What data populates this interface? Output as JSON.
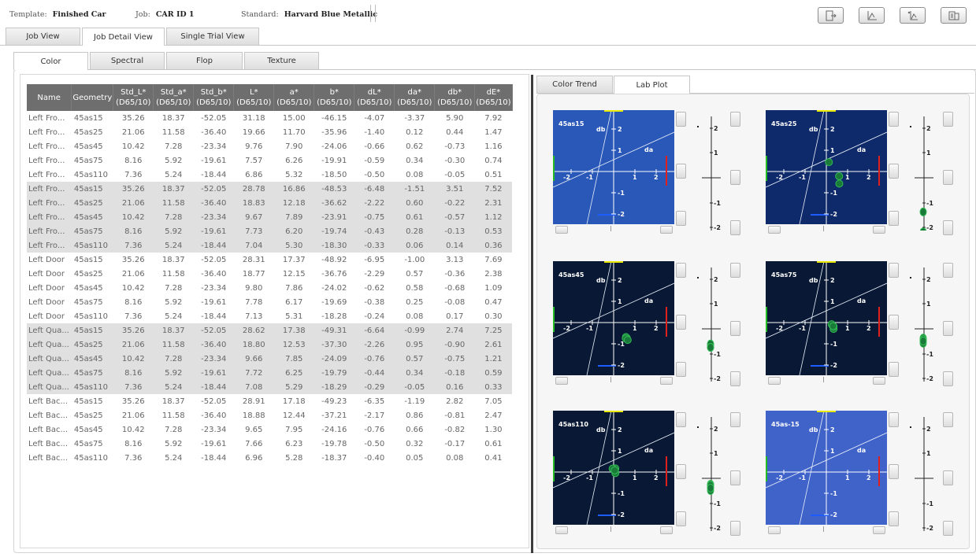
{
  "header": {
    "template_label": "Template:",
    "template_value": "Finished Car",
    "job_label": "Job:",
    "job_value": "CAR ID 1",
    "standard_label": "Standard:",
    "standard_value": "Harvard Blue Metallic"
  },
  "toolbar": {
    "buttons": [
      {
        "name": "export-icon"
      },
      {
        "name": "chart-icon"
      },
      {
        "name": "chart-star-icon"
      },
      {
        "name": "report-icon"
      }
    ]
  },
  "main_tabs": [
    "Job View",
    "Job Detail View",
    "Single Trial View"
  ],
  "main_active": 1,
  "sub_tabs": [
    "Color",
    "Spectral",
    "Flop",
    "Texture"
  ],
  "sub_active": 0,
  "right_tabs": [
    "Color Trend",
    "Lab Plot"
  ],
  "right_active": 1,
  "table": {
    "columns": [
      {
        "l1": "Name",
        "l2": ""
      },
      {
        "l1": "Geometry",
        "l2": ""
      },
      {
        "l1": "Std_L*",
        "l2": "(D65/10)"
      },
      {
        "l1": "Std_a*",
        "l2": "(D65/10)"
      },
      {
        "l1": "Std_b*",
        "l2": "(D65/10)"
      },
      {
        "l1": "L*",
        "l2": "(D65/10)"
      },
      {
        "l1": "a*",
        "l2": "(D65/10)"
      },
      {
        "l1": "b*",
        "l2": "(D65/10)"
      },
      {
        "l1": "dL*",
        "l2": "(D65/10)"
      },
      {
        "l1": "da*",
        "l2": "(D65/10)"
      },
      {
        "l1": "db*",
        "l2": "(D65/10)"
      },
      {
        "l1": "dE*",
        "l2": "(D65/10)"
      }
    ],
    "rows": [
      [
        "Left Fro...",
        "45as15",
        "35.26",
        "18.37",
        "-52.05",
        "31.18",
        "15.00",
        "-46.15",
        "-4.07",
        "-3.37",
        "5.90",
        "7.92"
      ],
      [
        "Left Fro...",
        "45as25",
        "21.06",
        "11.58",
        "-36.40",
        "19.66",
        "11.70",
        "-35.96",
        "-1.40",
        "0.12",
        "0.44",
        "1.47"
      ],
      [
        "Left Fro...",
        "45as45",
        "10.42",
        "7.28",
        "-23.34",
        "9.76",
        "7.90",
        "-24.06",
        "-0.66",
        "0.62",
        "-0.73",
        "1.16"
      ],
      [
        "Left Fro...",
        "45as75",
        "8.16",
        "5.92",
        "-19.61",
        "7.57",
        "6.26",
        "-19.91",
        "-0.59",
        "0.34",
        "-0.30",
        "0.74"
      ],
      [
        "Left Fro...",
        "45as110",
        "7.36",
        "5.24",
        "-18.44",
        "6.86",
        "5.32",
        "-18.50",
        "-0.50",
        "0.08",
        "-0.05",
        "0.51"
      ],
      [
        "Left Fro...",
        "45as15",
        "35.26",
        "18.37",
        "-52.05",
        "28.78",
        "16.86",
        "-48.53",
        "-6.48",
        "-1.51",
        "3.51",
        "7.52"
      ],
      [
        "Left Fro...",
        "45as25",
        "21.06",
        "11.58",
        "-36.40",
        "18.83",
        "12.18",
        "-36.62",
        "-2.22",
        "0.60",
        "-0.22",
        "2.31"
      ],
      [
        "Left Fro...",
        "45as45",
        "10.42",
        "7.28",
        "-23.34",
        "9.67",
        "7.89",
        "-23.91",
        "-0.75",
        "0.61",
        "-0.57",
        "1.12"
      ],
      [
        "Left Fro...",
        "45as75",
        "8.16",
        "5.92",
        "-19.61",
        "7.73",
        "6.20",
        "-19.74",
        "-0.43",
        "0.28",
        "-0.13",
        "0.53"
      ],
      [
        "Left Fro...",
        "45as110",
        "7.36",
        "5.24",
        "-18.44",
        "7.04",
        "5.30",
        "-18.30",
        "-0.33",
        "0.06",
        "0.14",
        "0.36"
      ],
      [
        "Left Door",
        "45as15",
        "35.26",
        "18.37",
        "-52.05",
        "28.31",
        "17.37",
        "-48.92",
        "-6.95",
        "-1.00",
        "3.13",
        "7.69"
      ],
      [
        "Left Door",
        "45as25",
        "21.06",
        "11.58",
        "-36.40",
        "18.77",
        "12.15",
        "-36.76",
        "-2.29",
        "0.57",
        "-0.36",
        "2.38"
      ],
      [
        "Left Door",
        "45as45",
        "10.42",
        "7.28",
        "-23.34",
        "9.80",
        "7.86",
        "-24.02",
        "-0.62",
        "0.58",
        "-0.68",
        "1.09"
      ],
      [
        "Left Door",
        "45as75",
        "8.16",
        "5.92",
        "-19.61",
        "7.78",
        "6.17",
        "-19.69",
        "-0.38",
        "0.25",
        "-0.08",
        "0.47"
      ],
      [
        "Left Door",
        "45as110",
        "7.36",
        "5.24",
        "-18.44",
        "7.13",
        "5.31",
        "-18.28",
        "-0.24",
        "0.08",
        "0.17",
        "0.30"
      ],
      [
        "Left Qua...",
        "45as15",
        "35.26",
        "18.37",
        "-52.05",
        "28.62",
        "17.38",
        "-49.31",
        "-6.64",
        "-0.99",
        "2.74",
        "7.25"
      ],
      [
        "Left Qua...",
        "45as25",
        "21.06",
        "11.58",
        "-36.40",
        "18.80",
        "12.53",
        "-37.30",
        "-2.26",
        "0.95",
        "-0.90",
        "2.61"
      ],
      [
        "Left Qua...",
        "45as45",
        "10.42",
        "7.28",
        "-23.34",
        "9.66",
        "7.85",
        "-24.09",
        "-0.76",
        "0.57",
        "-0.75",
        "1.21"
      ],
      [
        "Left Qua...",
        "45as75",
        "8.16",
        "5.92",
        "-19.61",
        "7.72",
        "6.25",
        "-19.79",
        "-0.44",
        "0.34",
        "-0.18",
        "0.59"
      ],
      [
        "Left Qua...",
        "45as110",
        "7.36",
        "5.24",
        "-18.44",
        "7.08",
        "5.29",
        "-18.29",
        "-0.29",
        "-0.05",
        "0.16",
        "0.33"
      ],
      [
        "Left Bac...",
        "45as15",
        "35.26",
        "18.37",
        "-52.05",
        "28.91",
        "17.18",
        "-49.23",
        "-6.35",
        "-1.19",
        "2.82",
        "7.05"
      ],
      [
        "Left Bac...",
        "45as25",
        "21.06",
        "11.58",
        "-36.40",
        "18.88",
        "12.44",
        "-37.21",
        "-2.17",
        "0.86",
        "-0.81",
        "2.47"
      ],
      [
        "Left Bac...",
        "45as45",
        "10.42",
        "7.28",
        "-23.34",
        "9.65",
        "7.95",
        "-24.16",
        "-0.76",
        "0.66",
        "-0.82",
        "1.30"
      ],
      [
        "Left Bac...",
        "45as75",
        "8.16",
        "5.92",
        "-19.61",
        "7.66",
        "6.23",
        "-19.78",
        "-0.50",
        "0.32",
        "-0.17",
        "0.61"
      ],
      [
        "Left Bac...",
        "45as110",
        "7.36",
        "5.24",
        "-18.44",
        "6.96",
        "5.28",
        "-18.37",
        "-0.40",
        "0.05",
        "0.08",
        "0.41"
      ]
    ],
    "shaded_groups": [
      1,
      3
    ]
  },
  "lab_plots": [
    {
      "label": "45as15",
      "bg": "#2a58b8",
      "da_label": "da",
      "db_label": "db",
      "ticks": {
        "neg2": "-2",
        "neg1": "-1",
        "pos1": "1",
        "pos2": "2"
      },
      "points": []
    },
    {
      "label": "45as25",
      "bg": "#0e2a6a",
      "da_label": "da",
      "db_label": "db",
      "ticks": {
        "neg2": "-2",
        "neg1": "-1",
        "pos1": "1",
        "pos2": "2"
      },
      "points": [
        [
          0.12,
          0.44
        ],
        [
          0.6,
          -0.22
        ],
        [
          0.61,
          -0.57
        ]
      ],
      "l_points": [
        -1.4,
        -2.22
      ]
    },
    {
      "label": "45as45",
      "bg": "#091935",
      "da_label": "da",
      "db_label": "db",
      "ticks": {
        "neg2": "-2",
        "neg1": "-1",
        "pos1": "1",
        "pos2": "2"
      },
      "points": [
        [
          0.62,
          -0.73
        ],
        [
          0.58,
          -0.68
        ],
        [
          0.57,
          -0.75
        ],
        [
          0.66,
          -0.82
        ]
      ],
      "l_points": [
        -0.66,
        -0.75,
        -0.62,
        -0.76,
        -0.76
      ]
    },
    {
      "label": "45as75",
      "bg": "#091935",
      "da_label": "da",
      "db_label": "db",
      "ticks": {
        "neg2": "-2",
        "neg1": "-1",
        "pos1": "1",
        "pos2": "2"
      },
      "points": [
        [
          0.34,
          -0.3
        ],
        [
          0.28,
          -0.13
        ],
        [
          0.25,
          -0.08
        ],
        [
          0.34,
          -0.18
        ],
        [
          0.32,
          -0.17
        ]
      ],
      "l_points": [
        -0.59,
        -0.43,
        -0.38,
        -0.44,
        -0.5
      ]
    },
    {
      "label": "45as110",
      "bg": "#091935",
      "da_label": "da",
      "db_label": "db",
      "ticks": {
        "neg2": "-2",
        "neg1": "-1",
        "pos1": "1",
        "pos2": "2"
      },
      "points": [
        [
          0.08,
          -0.05
        ],
        [
          0.06,
          0.14
        ],
        [
          0.08,
          0.17
        ],
        [
          -0.05,
          0.16
        ],
        [
          0.05,
          0.08
        ]
      ],
      "l_points": [
        -0.5,
        -0.33,
        -0.24,
        -0.29,
        -0.4
      ]
    },
    {
      "label": "45as-15",
      "bg": "#3f63c9",
      "da_label": "da",
      "db_label": "db",
      "ticks": {
        "neg2": "-2",
        "neg1": "-1",
        "pos1": "1",
        "pos2": "2"
      },
      "points": []
    }
  ],
  "colors": {
    "point": "#1a7a3a",
    "axis": "#ffffff",
    "yellow_mark": "#e8e800",
    "red_mark": "#e0201c",
    "green_mark": "#22bb22",
    "blue_mark": "#1f5cff"
  }
}
